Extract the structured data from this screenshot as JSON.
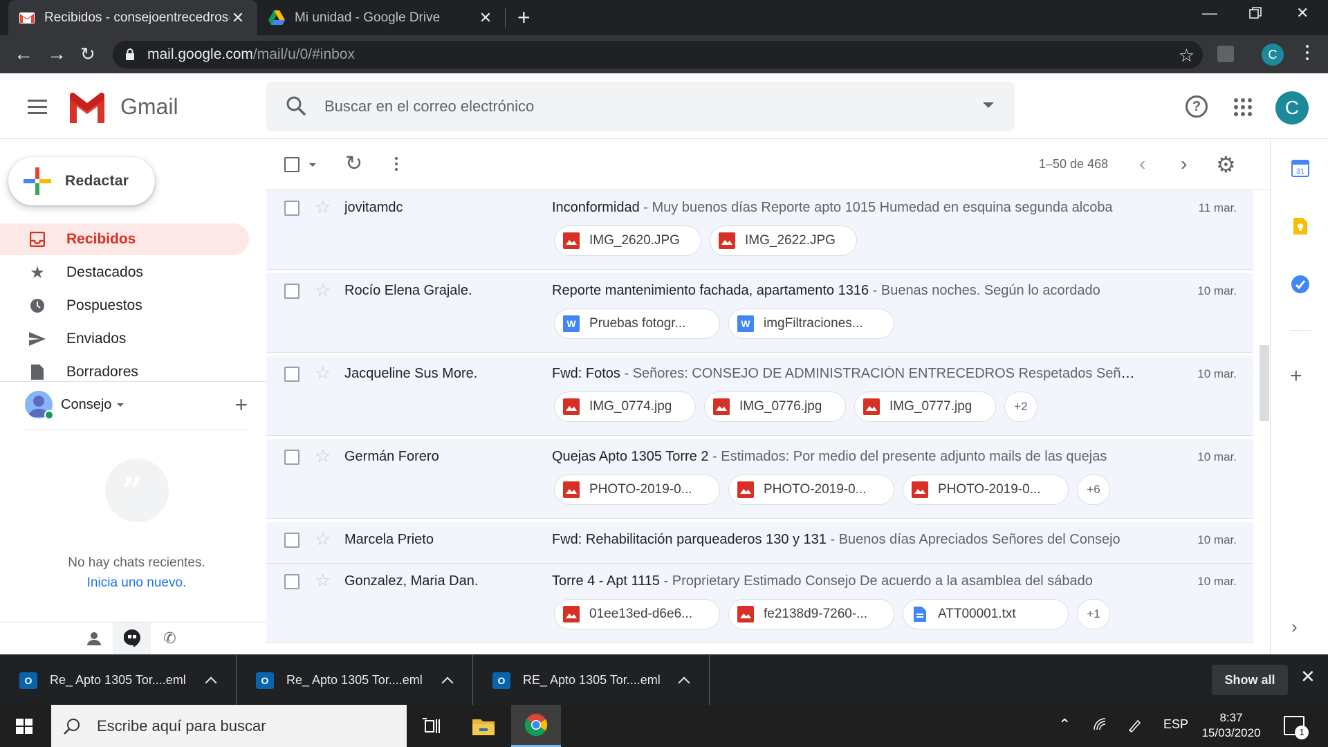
{
  "browser": {
    "tabs": [
      {
        "title": "Recibidos - consejoentrecedros@",
        "close": "✕"
      },
      {
        "title": "Mi unidad - Google Drive",
        "close": "✕"
      }
    ],
    "new_tab": "+",
    "url_host": "mail.google.com",
    "url_path": "/mail/u/0/#inbox",
    "profile_initial": "C"
  },
  "gmail": {
    "brand": "Gmail",
    "search_placeholder": "Buscar en el correo electrónico",
    "account_initial": "C",
    "compose_label": "Redactar",
    "nav": [
      {
        "label": "Recibidos",
        "icon": "inbox-icon"
      },
      {
        "label": "Destacados",
        "icon": "star-icon"
      },
      {
        "label": "Pospuestos",
        "icon": "clock-icon"
      },
      {
        "label": "Enviados",
        "icon": "send-icon"
      },
      {
        "label": "Borradores",
        "icon": "draft-icon"
      }
    ],
    "hangouts": {
      "user": "Consejo",
      "no_chats": "No hay chats recientes.",
      "start_new": "Inicia uno nuevo."
    },
    "pager": "1–50 de 468",
    "emails": [
      {
        "sender": "jovitamdc",
        "subject": "Inconformidad",
        "snippet": " - Muy buenos días Reporte apto 1015 Humedad en esquina segunda alcoba",
        "date": "11 mar.",
        "attachments": [
          {
            "name": "IMG_2620.JPG",
            "type": "img"
          },
          {
            "name": "IMG_2622.JPG",
            "type": "img"
          }
        ],
        "more": ""
      },
      {
        "sender": "Rocío Elena Grajale.",
        "subject": "Reporte mantenimiento fachada, apartamento 1316",
        "snippet": " - Buenas noches. Según lo acordado",
        "date": "10 mar.",
        "attachments": [
          {
            "name": "Pruebas fotogr...",
            "type": "doc"
          },
          {
            "name": "imgFiltraciones...",
            "type": "doc"
          }
        ],
        "more": ""
      },
      {
        "sender": "Jacqueline Sus More.",
        "subject": "Fwd: Fotos",
        "snippet": " - Señores: CONSEJO DE ADMINISTRACIÓN ENTRECEDROS Respetados Señores",
        "date": "10 mar.",
        "attachments": [
          {
            "name": "IMG_0774.jpg",
            "type": "img"
          },
          {
            "name": "IMG_0776.jpg",
            "type": "img"
          },
          {
            "name": "IMG_0777.jpg",
            "type": "img"
          }
        ],
        "more": "+2"
      },
      {
        "sender": "Germán Forero",
        "subject": "Quejas Apto 1305 Torre 2",
        "snippet": " - Estimados: Por medio del presente adjunto mails de las quejas",
        "date": "10 mar.",
        "attachments": [
          {
            "name": "PHOTO-2019-0...",
            "type": "img"
          },
          {
            "name": "PHOTO-2019-0...",
            "type": "img"
          },
          {
            "name": "PHOTO-2019-0...",
            "type": "img"
          }
        ],
        "more": "+6"
      },
      {
        "sender": "Marcela Prieto",
        "subject": "Fwd: Rehabilitación parqueaderos 130 y 131",
        "snippet": " - Buenos días Apreciados Señores del Consejo",
        "date": "10 mar.",
        "attachments": [],
        "more": ""
      },
      {
        "sender": "Gonzalez, Maria Dan.",
        "subject": "Torre 4 - Apt 1115",
        "snippet": " - Proprietary Estimado Consejo De acuerdo a la asamblea del sábado",
        "date": "10 mar.",
        "attachments": [
          {
            "name": "01ee13ed-d6e6...",
            "type": "img"
          },
          {
            "name": "fe2138d9-7260-...",
            "type": "img"
          },
          {
            "name": "ATT00001.txt",
            "type": "txt"
          }
        ],
        "more": "+1"
      }
    ]
  },
  "downloads": {
    "items": [
      "Re_ Apto 1305 Tor....eml",
      "Re_ Apto 1305 Tor....eml",
      "RE_ Apto 1305 Tor....eml"
    ],
    "show_all": "Show all",
    "outlook_letter": "O"
  },
  "taskbar": {
    "search_placeholder": "Escribe aquí para buscar",
    "lang": "ESP",
    "time": "8:37",
    "date": "15/03/2020",
    "notifications": "1"
  },
  "colors": {
    "gmail_red": "#d93025",
    "accent_blue": "#1a73e8",
    "row_read_bg": "#f2f6fc",
    "avatar_teal": "#1c8a9b"
  }
}
